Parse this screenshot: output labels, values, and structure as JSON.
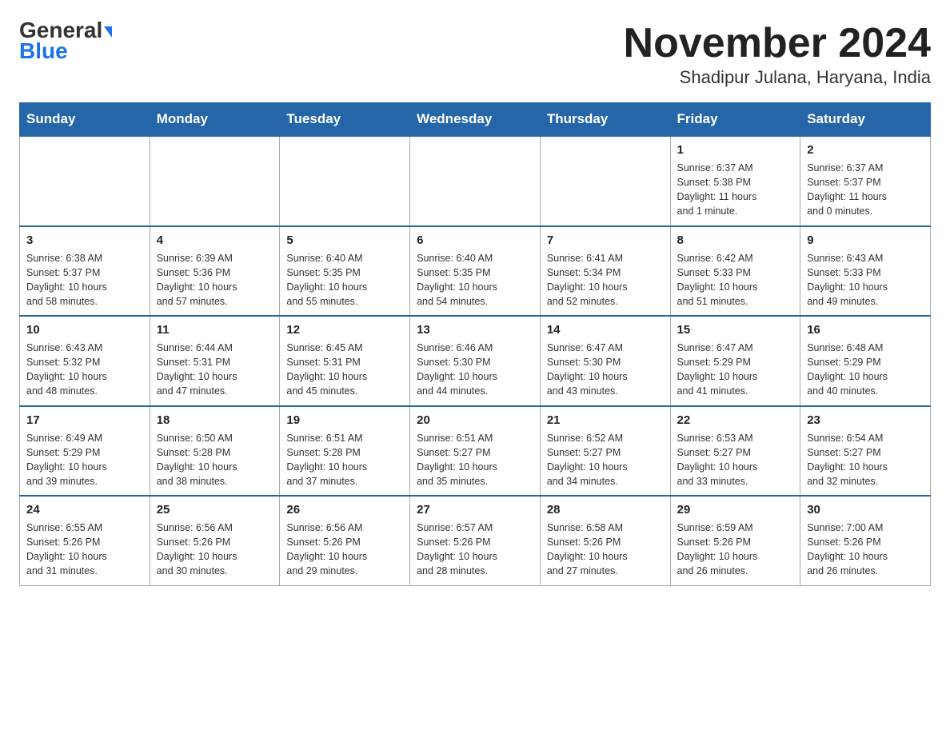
{
  "header": {
    "logo_line1": "General",
    "logo_line2": "Blue",
    "title": "November 2024",
    "subtitle": "Shadipur Julana, Haryana, India"
  },
  "days_of_week": [
    "Sunday",
    "Monday",
    "Tuesday",
    "Wednesday",
    "Thursday",
    "Friday",
    "Saturday"
  ],
  "weeks": [
    [
      {
        "day": "",
        "info": ""
      },
      {
        "day": "",
        "info": ""
      },
      {
        "day": "",
        "info": ""
      },
      {
        "day": "",
        "info": ""
      },
      {
        "day": "",
        "info": ""
      },
      {
        "day": "1",
        "info": "Sunrise: 6:37 AM\nSunset: 5:38 PM\nDaylight: 11 hours\nand 1 minute."
      },
      {
        "day": "2",
        "info": "Sunrise: 6:37 AM\nSunset: 5:37 PM\nDaylight: 11 hours\nand 0 minutes."
      }
    ],
    [
      {
        "day": "3",
        "info": "Sunrise: 6:38 AM\nSunset: 5:37 PM\nDaylight: 10 hours\nand 58 minutes."
      },
      {
        "day": "4",
        "info": "Sunrise: 6:39 AM\nSunset: 5:36 PM\nDaylight: 10 hours\nand 57 minutes."
      },
      {
        "day": "5",
        "info": "Sunrise: 6:40 AM\nSunset: 5:35 PM\nDaylight: 10 hours\nand 55 minutes."
      },
      {
        "day": "6",
        "info": "Sunrise: 6:40 AM\nSunset: 5:35 PM\nDaylight: 10 hours\nand 54 minutes."
      },
      {
        "day": "7",
        "info": "Sunrise: 6:41 AM\nSunset: 5:34 PM\nDaylight: 10 hours\nand 52 minutes."
      },
      {
        "day": "8",
        "info": "Sunrise: 6:42 AM\nSunset: 5:33 PM\nDaylight: 10 hours\nand 51 minutes."
      },
      {
        "day": "9",
        "info": "Sunrise: 6:43 AM\nSunset: 5:33 PM\nDaylight: 10 hours\nand 49 minutes."
      }
    ],
    [
      {
        "day": "10",
        "info": "Sunrise: 6:43 AM\nSunset: 5:32 PM\nDaylight: 10 hours\nand 48 minutes."
      },
      {
        "day": "11",
        "info": "Sunrise: 6:44 AM\nSunset: 5:31 PM\nDaylight: 10 hours\nand 47 minutes."
      },
      {
        "day": "12",
        "info": "Sunrise: 6:45 AM\nSunset: 5:31 PM\nDaylight: 10 hours\nand 45 minutes."
      },
      {
        "day": "13",
        "info": "Sunrise: 6:46 AM\nSunset: 5:30 PM\nDaylight: 10 hours\nand 44 minutes."
      },
      {
        "day": "14",
        "info": "Sunrise: 6:47 AM\nSunset: 5:30 PM\nDaylight: 10 hours\nand 43 minutes."
      },
      {
        "day": "15",
        "info": "Sunrise: 6:47 AM\nSunset: 5:29 PM\nDaylight: 10 hours\nand 41 minutes."
      },
      {
        "day": "16",
        "info": "Sunrise: 6:48 AM\nSunset: 5:29 PM\nDaylight: 10 hours\nand 40 minutes."
      }
    ],
    [
      {
        "day": "17",
        "info": "Sunrise: 6:49 AM\nSunset: 5:29 PM\nDaylight: 10 hours\nand 39 minutes."
      },
      {
        "day": "18",
        "info": "Sunrise: 6:50 AM\nSunset: 5:28 PM\nDaylight: 10 hours\nand 38 minutes."
      },
      {
        "day": "19",
        "info": "Sunrise: 6:51 AM\nSunset: 5:28 PM\nDaylight: 10 hours\nand 37 minutes."
      },
      {
        "day": "20",
        "info": "Sunrise: 6:51 AM\nSunset: 5:27 PM\nDaylight: 10 hours\nand 35 minutes."
      },
      {
        "day": "21",
        "info": "Sunrise: 6:52 AM\nSunset: 5:27 PM\nDaylight: 10 hours\nand 34 minutes."
      },
      {
        "day": "22",
        "info": "Sunrise: 6:53 AM\nSunset: 5:27 PM\nDaylight: 10 hours\nand 33 minutes."
      },
      {
        "day": "23",
        "info": "Sunrise: 6:54 AM\nSunset: 5:27 PM\nDaylight: 10 hours\nand 32 minutes."
      }
    ],
    [
      {
        "day": "24",
        "info": "Sunrise: 6:55 AM\nSunset: 5:26 PM\nDaylight: 10 hours\nand 31 minutes."
      },
      {
        "day": "25",
        "info": "Sunrise: 6:56 AM\nSunset: 5:26 PM\nDaylight: 10 hours\nand 30 minutes."
      },
      {
        "day": "26",
        "info": "Sunrise: 6:56 AM\nSunset: 5:26 PM\nDaylight: 10 hours\nand 29 minutes."
      },
      {
        "day": "27",
        "info": "Sunrise: 6:57 AM\nSunset: 5:26 PM\nDaylight: 10 hours\nand 28 minutes."
      },
      {
        "day": "28",
        "info": "Sunrise: 6:58 AM\nSunset: 5:26 PM\nDaylight: 10 hours\nand 27 minutes."
      },
      {
        "day": "29",
        "info": "Sunrise: 6:59 AM\nSunset: 5:26 PM\nDaylight: 10 hours\nand 26 minutes."
      },
      {
        "day": "30",
        "info": "Sunrise: 7:00 AM\nSunset: 5:26 PM\nDaylight: 10 hours\nand 26 minutes."
      }
    ]
  ]
}
